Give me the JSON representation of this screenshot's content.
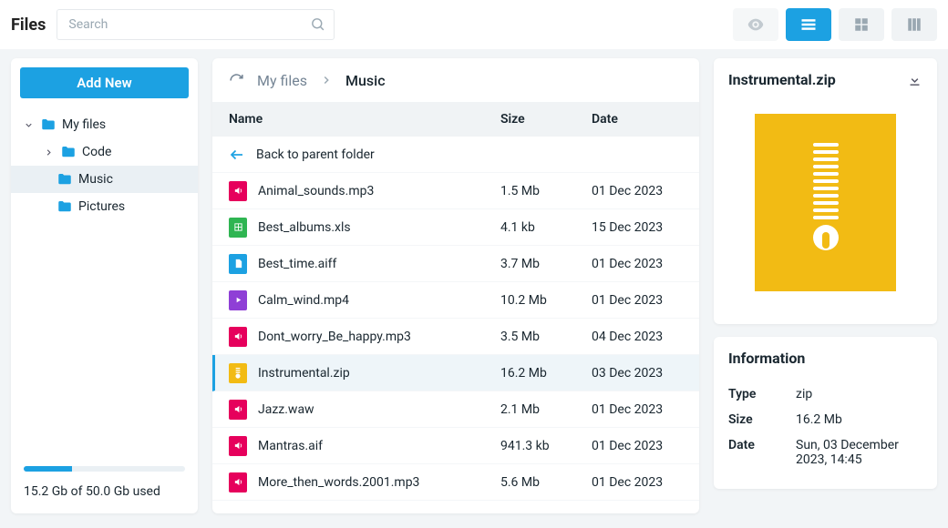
{
  "app_title": "Files",
  "search": {
    "placeholder": "Search"
  },
  "sidebar": {
    "add_button": "Add New",
    "tree": [
      {
        "label": "My files",
        "depth": 0,
        "expanded": true,
        "kind": "folder"
      },
      {
        "label": "Code",
        "depth": 1,
        "expanded": false,
        "kind": "folder"
      },
      {
        "label": "Music",
        "depth": 2,
        "selected": true,
        "kind": "folder"
      },
      {
        "label": "Pictures",
        "depth": 2,
        "kind": "folder"
      }
    ],
    "storage_used": "15.2 Gb of 50.0 Gb used",
    "storage_pct": 30
  },
  "breadcrumb": {
    "parent": "My files",
    "current": "Music"
  },
  "columns": {
    "name": "Name",
    "size": "Size",
    "date": "Date"
  },
  "back_label": "Back to parent folder",
  "files": [
    {
      "name": "Animal_sounds.mp3",
      "size": "1.5 Mb",
      "date": "01 Dec 2023",
      "type": "audio"
    },
    {
      "name": "Best_albums.xls",
      "size": "4.1 kb",
      "date": "15 Dec 2023",
      "type": "xls"
    },
    {
      "name": "Best_time.aiff",
      "size": "3.7 Mb",
      "date": "01 Dec 2023",
      "type": "file"
    },
    {
      "name": "Calm_wind.mp4",
      "size": "10.2 Mb",
      "date": "01 Dec 2023",
      "type": "video"
    },
    {
      "name": "Dont_worry_Be_happy.mp3",
      "size": "3.5 Mb",
      "date": "04 Dec 2023",
      "type": "audio"
    },
    {
      "name": "Instrumental.zip",
      "size": "16.2 Mb",
      "date": "03 Dec 2023",
      "type": "zip",
      "selected": true
    },
    {
      "name": "Jazz.waw",
      "size": "2.1 Mb",
      "date": "01 Dec 2023",
      "type": "audio"
    },
    {
      "name": "Mantras.aif",
      "size": "941.3 kb",
      "date": "01 Dec 2023",
      "type": "audio"
    },
    {
      "name": "More_then_words.2001.mp3",
      "size": "5.6 Mb",
      "date": "01 Dec 2023",
      "type": "audio"
    }
  ],
  "preview": {
    "title": "Instrumental.zip"
  },
  "info": {
    "title": "Information",
    "rows": [
      {
        "key": "Type",
        "val": "zip"
      },
      {
        "key": "Size",
        "val": "16.2 Mb"
      },
      {
        "key": "Date",
        "val": "Sun, 03 December 2023, 14:45"
      }
    ]
  }
}
